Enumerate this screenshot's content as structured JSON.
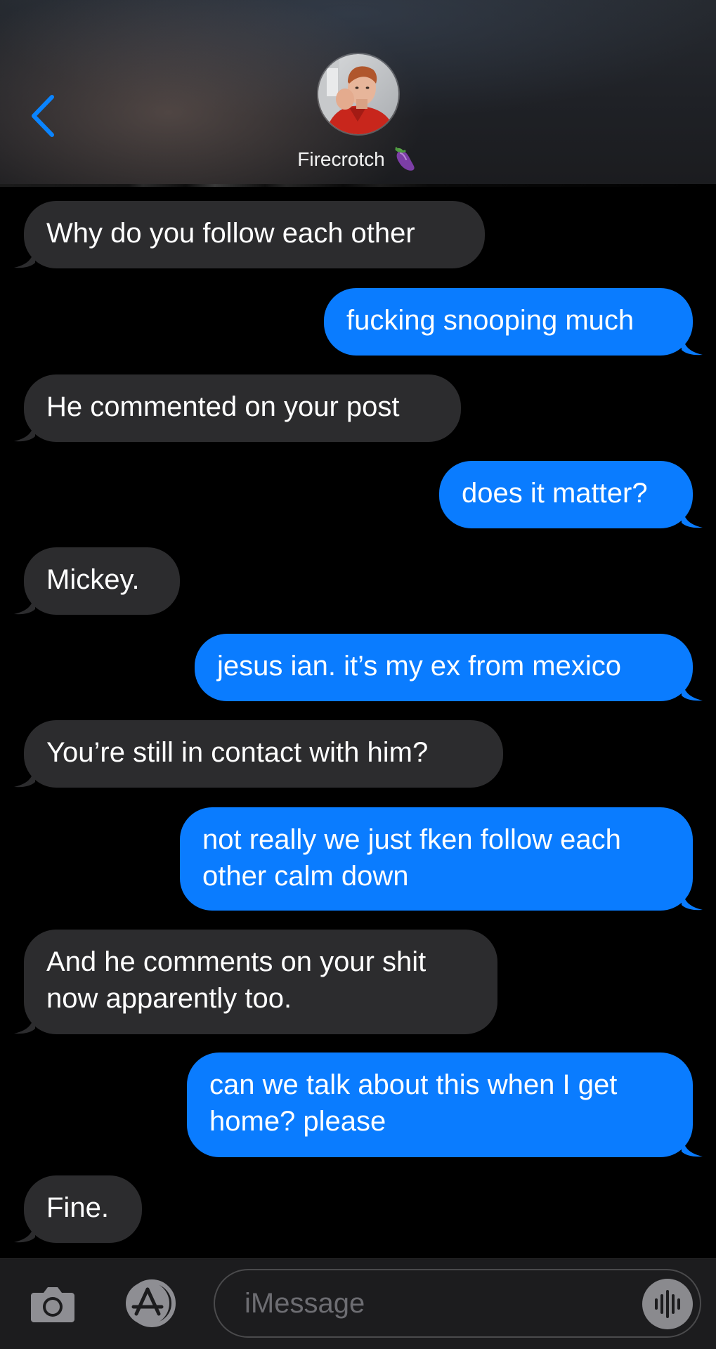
{
  "header": {
    "contact_name": "Firecrotch",
    "contact_emoji": "eggplant-emoji",
    "back_icon": "chevron-left-icon",
    "accent_color": "#0a84ff"
  },
  "messages": [
    {
      "sender": "them",
      "text": "Why do you follow each other"
    },
    {
      "sender": "me",
      "text": "fucking snooping much"
    },
    {
      "sender": "them",
      "text": "He commented on your post"
    },
    {
      "sender": "me",
      "text": "does it matter?"
    },
    {
      "sender": "them",
      "text": "Mickey."
    },
    {
      "sender": "me",
      "text": "jesus ian. it’s my ex from mexico"
    },
    {
      "sender": "them",
      "text": "You’re still in contact with him?"
    },
    {
      "sender": "me",
      "lines": [
        "not really we just fken follow each",
        "other calm down"
      ]
    },
    {
      "sender": "them",
      "lines": [
        "And he comments on your shit",
        "now apparently too."
      ]
    },
    {
      "sender": "me",
      "lines": [
        "can we talk about this when I get",
        "home? please"
      ]
    },
    {
      "sender": "them",
      "text": "Fine."
    }
  ],
  "colors": {
    "sent_bubble": "#0a7cff",
    "received_bubble": "#2c2c2e",
    "background": "#000000"
  },
  "input_bar": {
    "placeholder": "iMessage",
    "camera_icon": "camera-icon",
    "appstore_icon": "app-store-icon",
    "audio_icon": "audio-waveform-icon"
  }
}
